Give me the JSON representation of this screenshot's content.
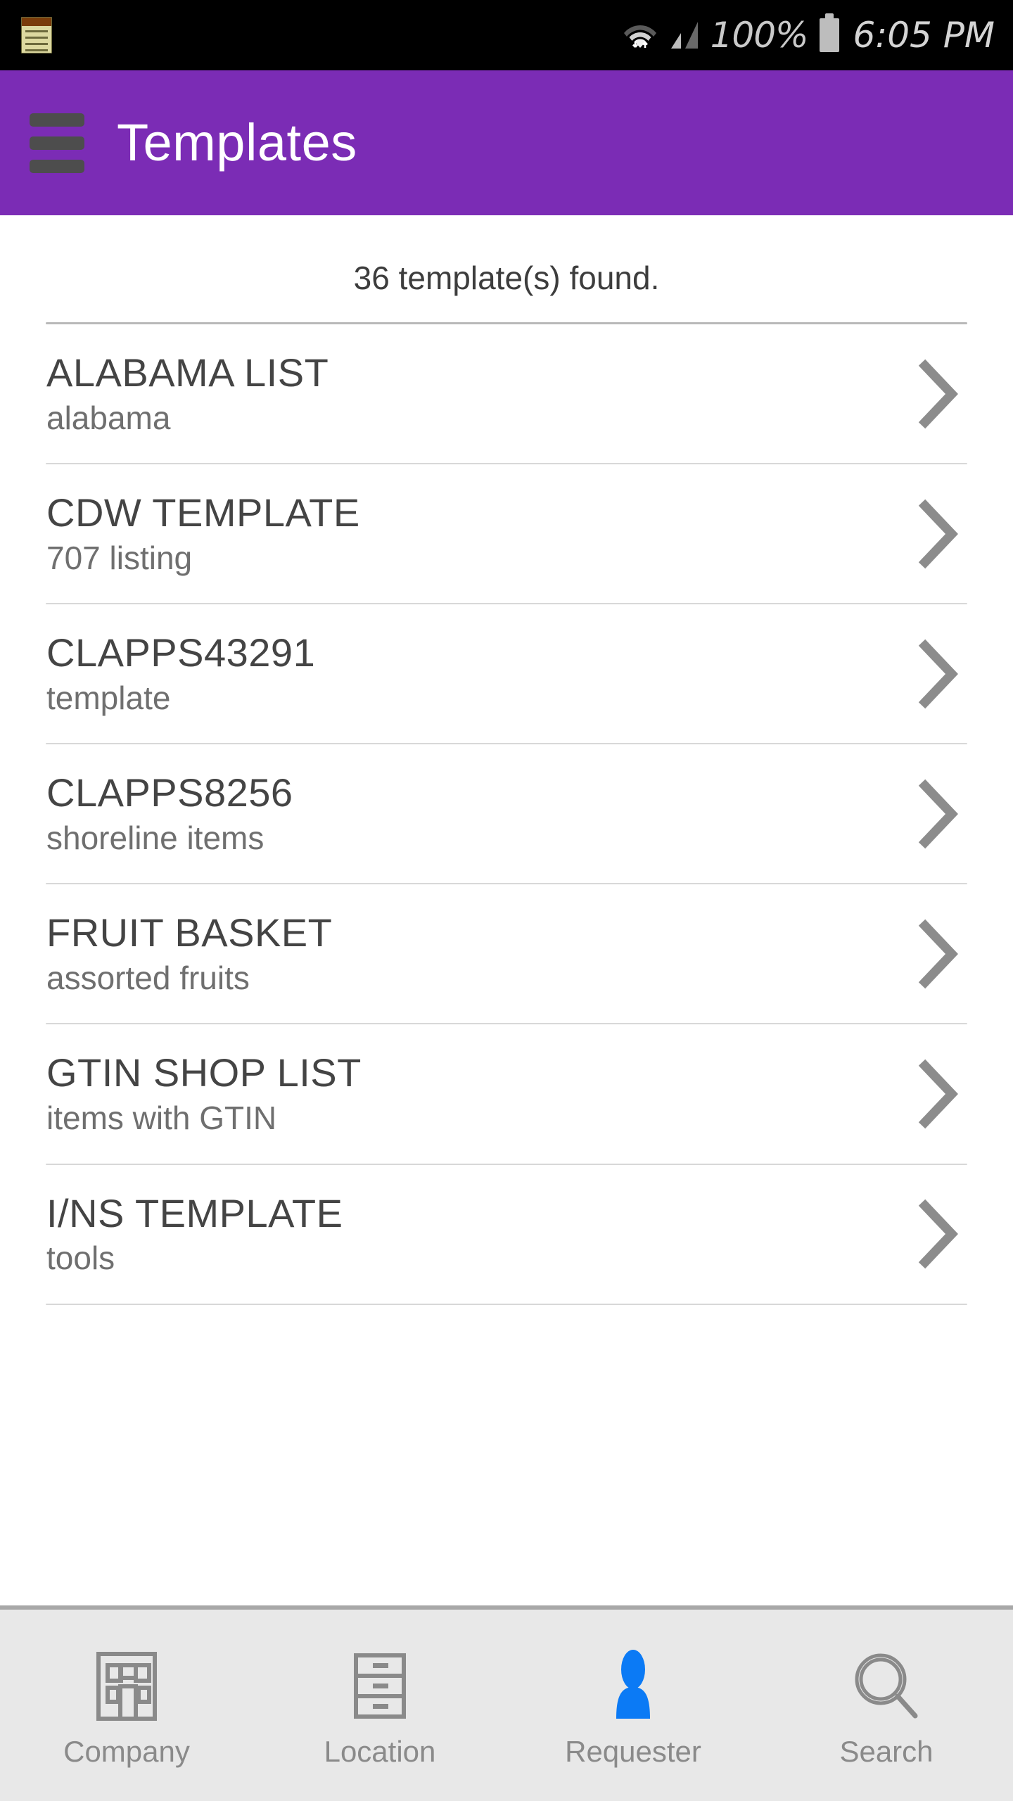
{
  "status_bar": {
    "notification_icon": "memo-icon",
    "wifi_icon": "wifi-icon",
    "signal_icon": "cellular-signal-icon",
    "battery_percent": "100%",
    "battery_icon": "battery-full-icon",
    "time": "6:05 PM",
    "background_color": "#000000",
    "text_color": "#c9c9c9"
  },
  "header": {
    "menu_icon": "hamburger-menu-icon",
    "title": "Templates",
    "background_color": "#7B2CB5",
    "title_color": "#ffffff"
  },
  "content": {
    "result_count_text": "36 template(s) found.",
    "chevron_icon": "chevron-right-icon",
    "templates": [
      {
        "title": "ALABAMA LIST",
        "subtitle": "alabama"
      },
      {
        "title": "CDW TEMPLATE",
        "subtitle": "707 listing"
      },
      {
        "title": "CLAPPS43291",
        "subtitle": "template"
      },
      {
        "title": "CLAPPS8256",
        "subtitle": "shoreline items"
      },
      {
        "title": "FRUIT BASKET",
        "subtitle": "assorted fruits"
      },
      {
        "title": "GTIN SHOP LIST",
        "subtitle": "items with GTIN"
      },
      {
        "title": "I/NS TEMPLATE",
        "subtitle": "tools"
      }
    ]
  },
  "bottom_nav": {
    "background_color": "#e8e8e8",
    "inactive_color": "#8a8a8a",
    "active_color": "#0B7AF5",
    "items": [
      {
        "label": "Company",
        "icon": "building-icon",
        "active": false
      },
      {
        "label": "Location",
        "icon": "filing-cabinet-icon",
        "active": false
      },
      {
        "label": "Requester",
        "icon": "person-icon",
        "active": true
      },
      {
        "label": "Search",
        "icon": "magnifier-icon",
        "active": false
      }
    ]
  }
}
